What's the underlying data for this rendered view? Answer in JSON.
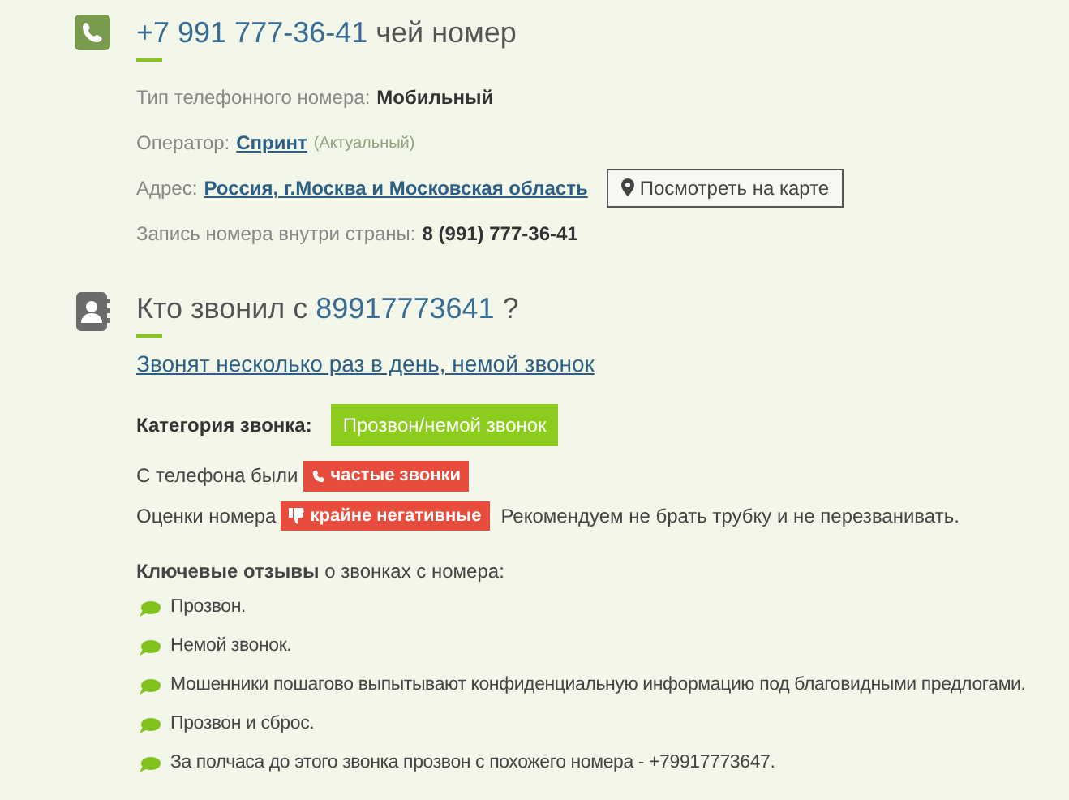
{
  "number_section": {
    "title_number": "+7 991 777-36-41",
    "title_suffix": "чей номер",
    "rows": [
      {
        "kind": "text",
        "label": "Тип телефонного номера:",
        "value": "Мобильный"
      },
      {
        "kind": "link",
        "label": "Оператор:",
        "value": "Спринт",
        "note": "(Актуальный)"
      },
      {
        "kind": "address",
        "label": "Адрес:",
        "value": "Россия, г.Москва и Московская область",
        "button": "Посмотреть на карте"
      },
      {
        "kind": "text",
        "label": "Запись номера внутри страны:",
        "value": "8 (991) 777-36-41"
      }
    ]
  },
  "caller_section": {
    "title_prefix": "Кто звонил с",
    "title_number": "89917773641",
    "title_end": "?",
    "summary_link": "Звонят несколько раз в день, немой звонок",
    "category": {
      "label": "Категория звонка:",
      "value": "Прозвон/немой звонок"
    },
    "calls": {
      "label": "С телефона были",
      "badge": "частые звонки"
    },
    "ratings": {
      "label": "Оценки номера",
      "badge": "крайне негативные",
      "advice": "Рекомендуем не брать трубку и не перезванивать."
    },
    "reviews_heading": "**Ключевые отзывы** о звонках с номера:",
    "reviews": [
      "Прозвон.",
      "Немой звонок.",
      "Мошенники пошагово выпытывают конфиденциальную информацию под благовидными предлогами.",
      "Прозвон и сброс.",
      "За полчаса до этого звонка прозвон с похожего номера - +79917773647."
    ]
  }
}
